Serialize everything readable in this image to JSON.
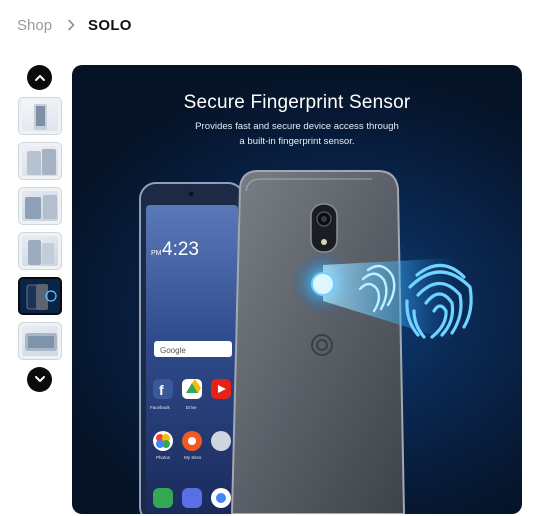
{
  "breadcrumb": {
    "shop_label": "Shop",
    "current_label": "SOLO"
  },
  "gallery": {
    "thumbnails": [
      {
        "label": "thumbnail-1",
        "active": false
      },
      {
        "label": "thumbnail-2",
        "active": false
      },
      {
        "label": "thumbnail-3",
        "active": false
      },
      {
        "label": "thumbnail-4",
        "active": false
      },
      {
        "label": "thumbnail-5",
        "active": true
      },
      {
        "label": "thumbnail-6",
        "active": false
      }
    ],
    "up_icon": "chevron-up-icon",
    "down_icon": "chevron-down-icon"
  },
  "hero": {
    "title": "Secure Fingerprint Sensor",
    "subtitle_line1": "Provides fast and secure device access through",
    "subtitle_line2": "a built-in fingerprint sensor.",
    "phone_clock": "4:23",
    "phone_clock_prefix": "PM",
    "search_brand": "Google",
    "apps": [
      {
        "label": "Facebook"
      },
      {
        "label": "Drive"
      },
      {
        "label": "Photos"
      },
      {
        "label": "My Sites"
      }
    ]
  },
  "colors": {
    "accent": "#0b0b0b",
    "hero_bg": "#0a2953",
    "glow": "#38b6ff"
  }
}
